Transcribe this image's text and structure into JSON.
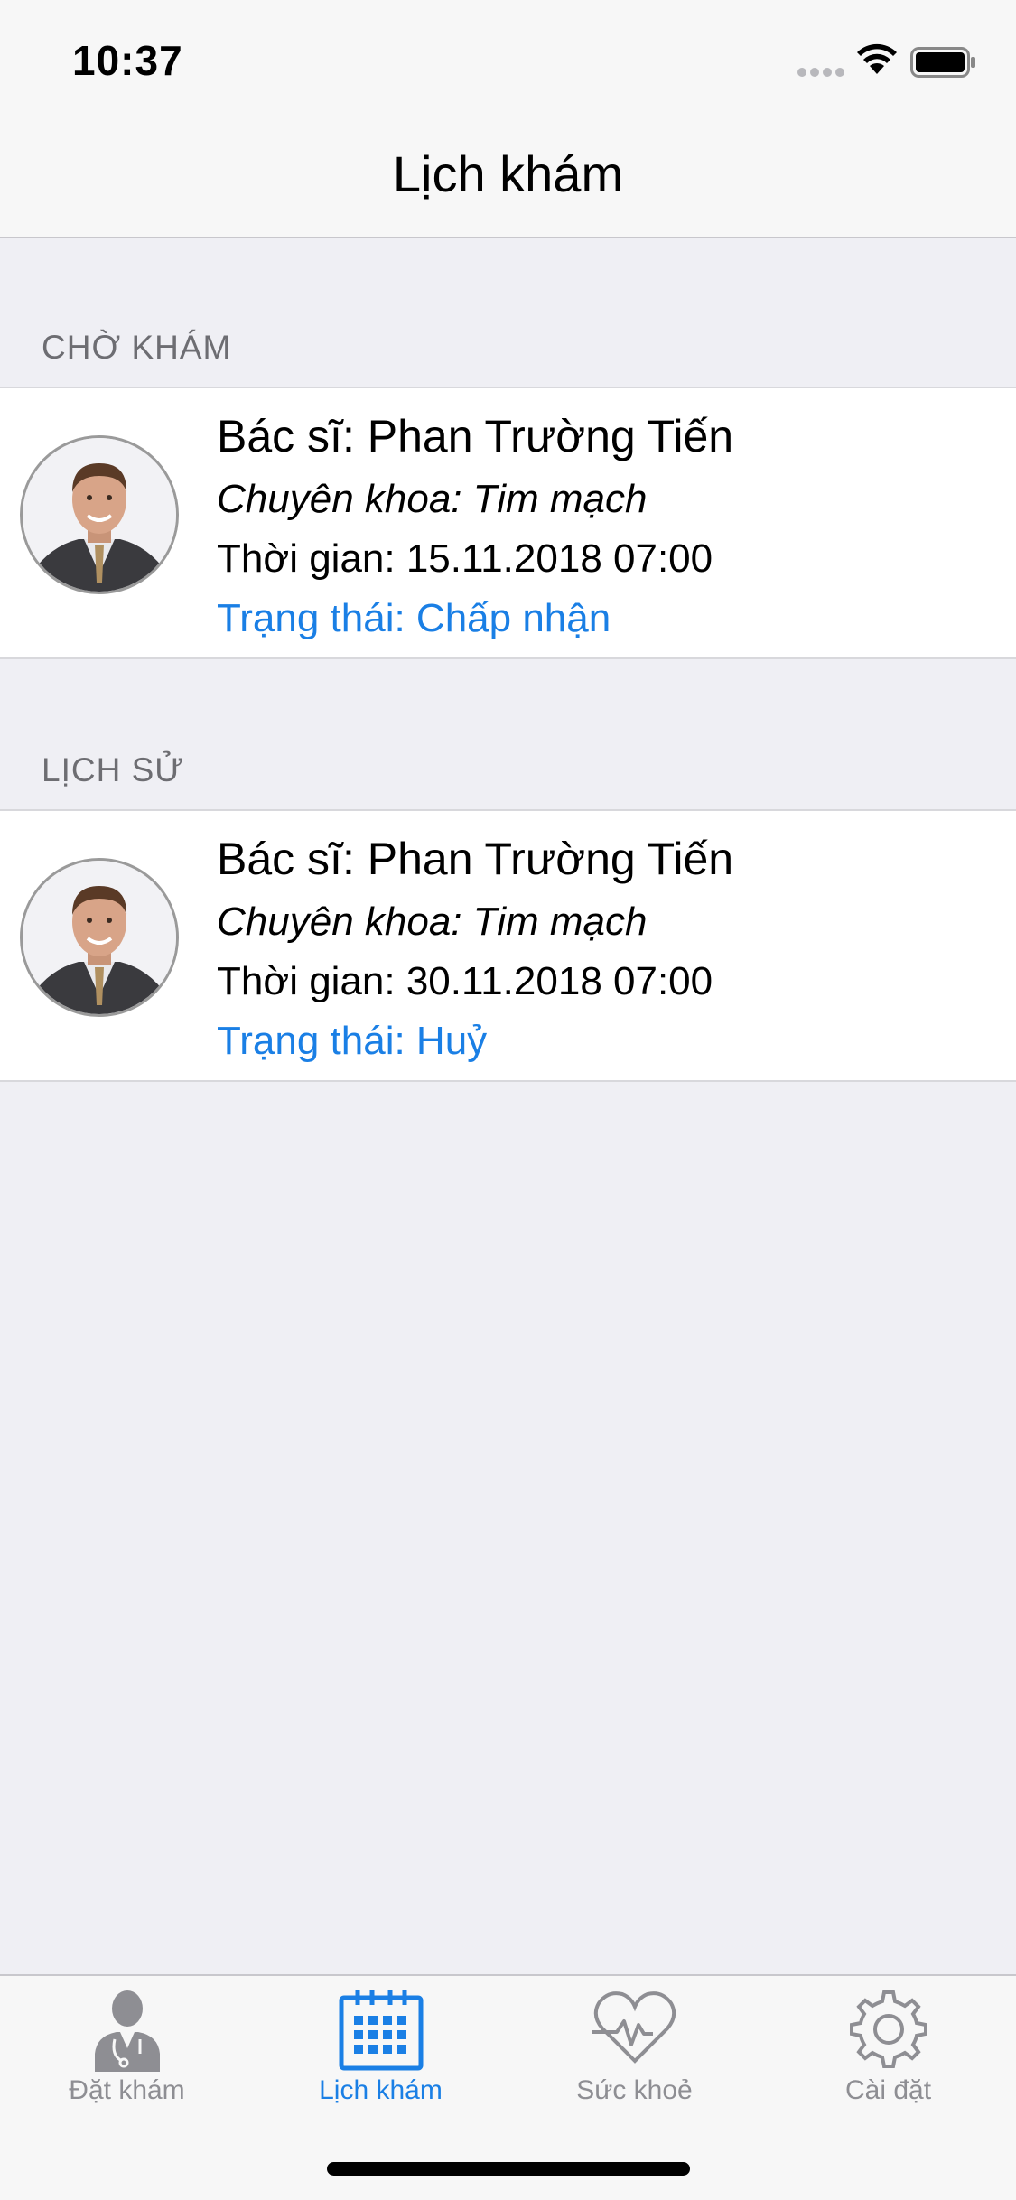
{
  "status_bar": {
    "time": "10:37",
    "icons": [
      "signal-dots-icon",
      "wifi-icon",
      "battery-icon"
    ]
  },
  "nav": {
    "title": "Lịch khám"
  },
  "sections": [
    {
      "header": "CHỜ KHÁM",
      "items": [
        {
          "doctor": "Bác sĩ: Phan Trường Tiến",
          "specialty": "Chuyên khoa: Tim mạch",
          "time": "Thời gian: 15.11.2018 07:00",
          "status": "Trạng thái: Chấp nhận"
        }
      ]
    },
    {
      "header": "LỊCH SỬ",
      "items": [
        {
          "doctor": "Bác sĩ: Phan Trường Tiến",
          "specialty": "Chuyên khoa: Tim mạch",
          "time": "Thời gian: 30.11.2018 07:00",
          "status": "Trạng thái: Huỷ"
        }
      ]
    }
  ],
  "tabs": [
    {
      "label": "Đặt khám",
      "icon": "doctor-icon",
      "active": false
    },
    {
      "label": "Lịch khám",
      "icon": "calendar-icon",
      "active": true
    },
    {
      "label": "Sức khoẻ",
      "icon": "heart-pulse-icon",
      "active": false
    },
    {
      "label": "Cài đặt",
      "icon": "gear-icon",
      "active": false
    }
  ],
  "colors": {
    "accent": "#1A7FE5",
    "inactive": "#8E8E93",
    "background": "#EFEFF4",
    "bar": "#F7F7F7"
  }
}
